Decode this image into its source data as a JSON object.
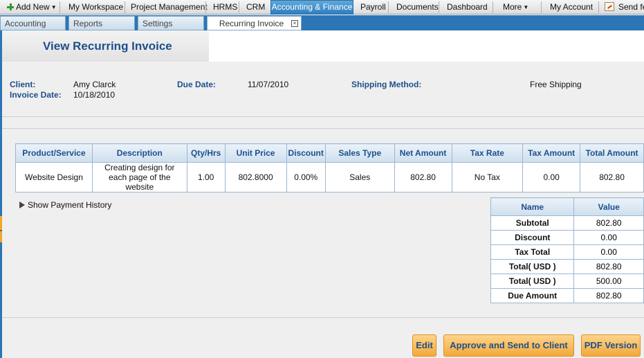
{
  "topnav": {
    "add_new": "Add New",
    "items": [
      "My Workspace",
      "Project Management",
      "HRMS",
      "CRM",
      "Accounting & Finance",
      "Payroll",
      "Documents",
      "Dashboard"
    ],
    "more": "More",
    "my_account": "My Account",
    "send": "Send fe"
  },
  "subtabs": {
    "accounting": "Accounting",
    "reports": "Reports",
    "settings": "Settings",
    "active": "Recurring Invoice",
    "close": "×"
  },
  "page": {
    "title": "View Recurring Invoice"
  },
  "invoice": {
    "client_label": "Client:",
    "client": "Amy Clarck",
    "invoice_date_label": "Invoice Date:",
    "invoice_date": "10/18/2010",
    "due_date_label": "Due Date:",
    "due_date": "11/07/2010",
    "shipping_label": "Shipping Method:",
    "shipping": "Free Shipping"
  },
  "items_table": {
    "headers": [
      "Product/Service",
      "Description",
      "Qty/Hrs",
      "Unit Price",
      "Discount",
      "Sales Type",
      "Net Amount",
      "Tax Rate",
      "Tax Amount",
      "Total Amount"
    ],
    "rows": [
      [
        "Website Design",
        "Creating design for each page of the website",
        "1.00",
        "802.8000",
        "0.00%",
        "Sales",
        "802.80",
        "No Tax",
        "0.00",
        "802.80"
      ]
    ]
  },
  "payment_history": "Show Payment History",
  "summary": {
    "headers": [
      "Name",
      "Value"
    ],
    "rows": [
      [
        "Subtotal",
        "802.80"
      ],
      [
        "Discount",
        "0.00"
      ],
      [
        "Tax Total",
        "0.00"
      ],
      [
        "Total( USD )",
        "802.80"
      ],
      [
        "Total( USD )",
        "500.00"
      ],
      [
        "Due Amount",
        "802.80"
      ]
    ]
  },
  "buttons": {
    "edit": "Edit",
    "approve": "Approve and Send to Client",
    "pdf": "PDF Version"
  },
  "colors": {
    "accent": "#2c76b6",
    "label_blue": "#1e4f8a",
    "button_orange": "#f2a93b"
  }
}
